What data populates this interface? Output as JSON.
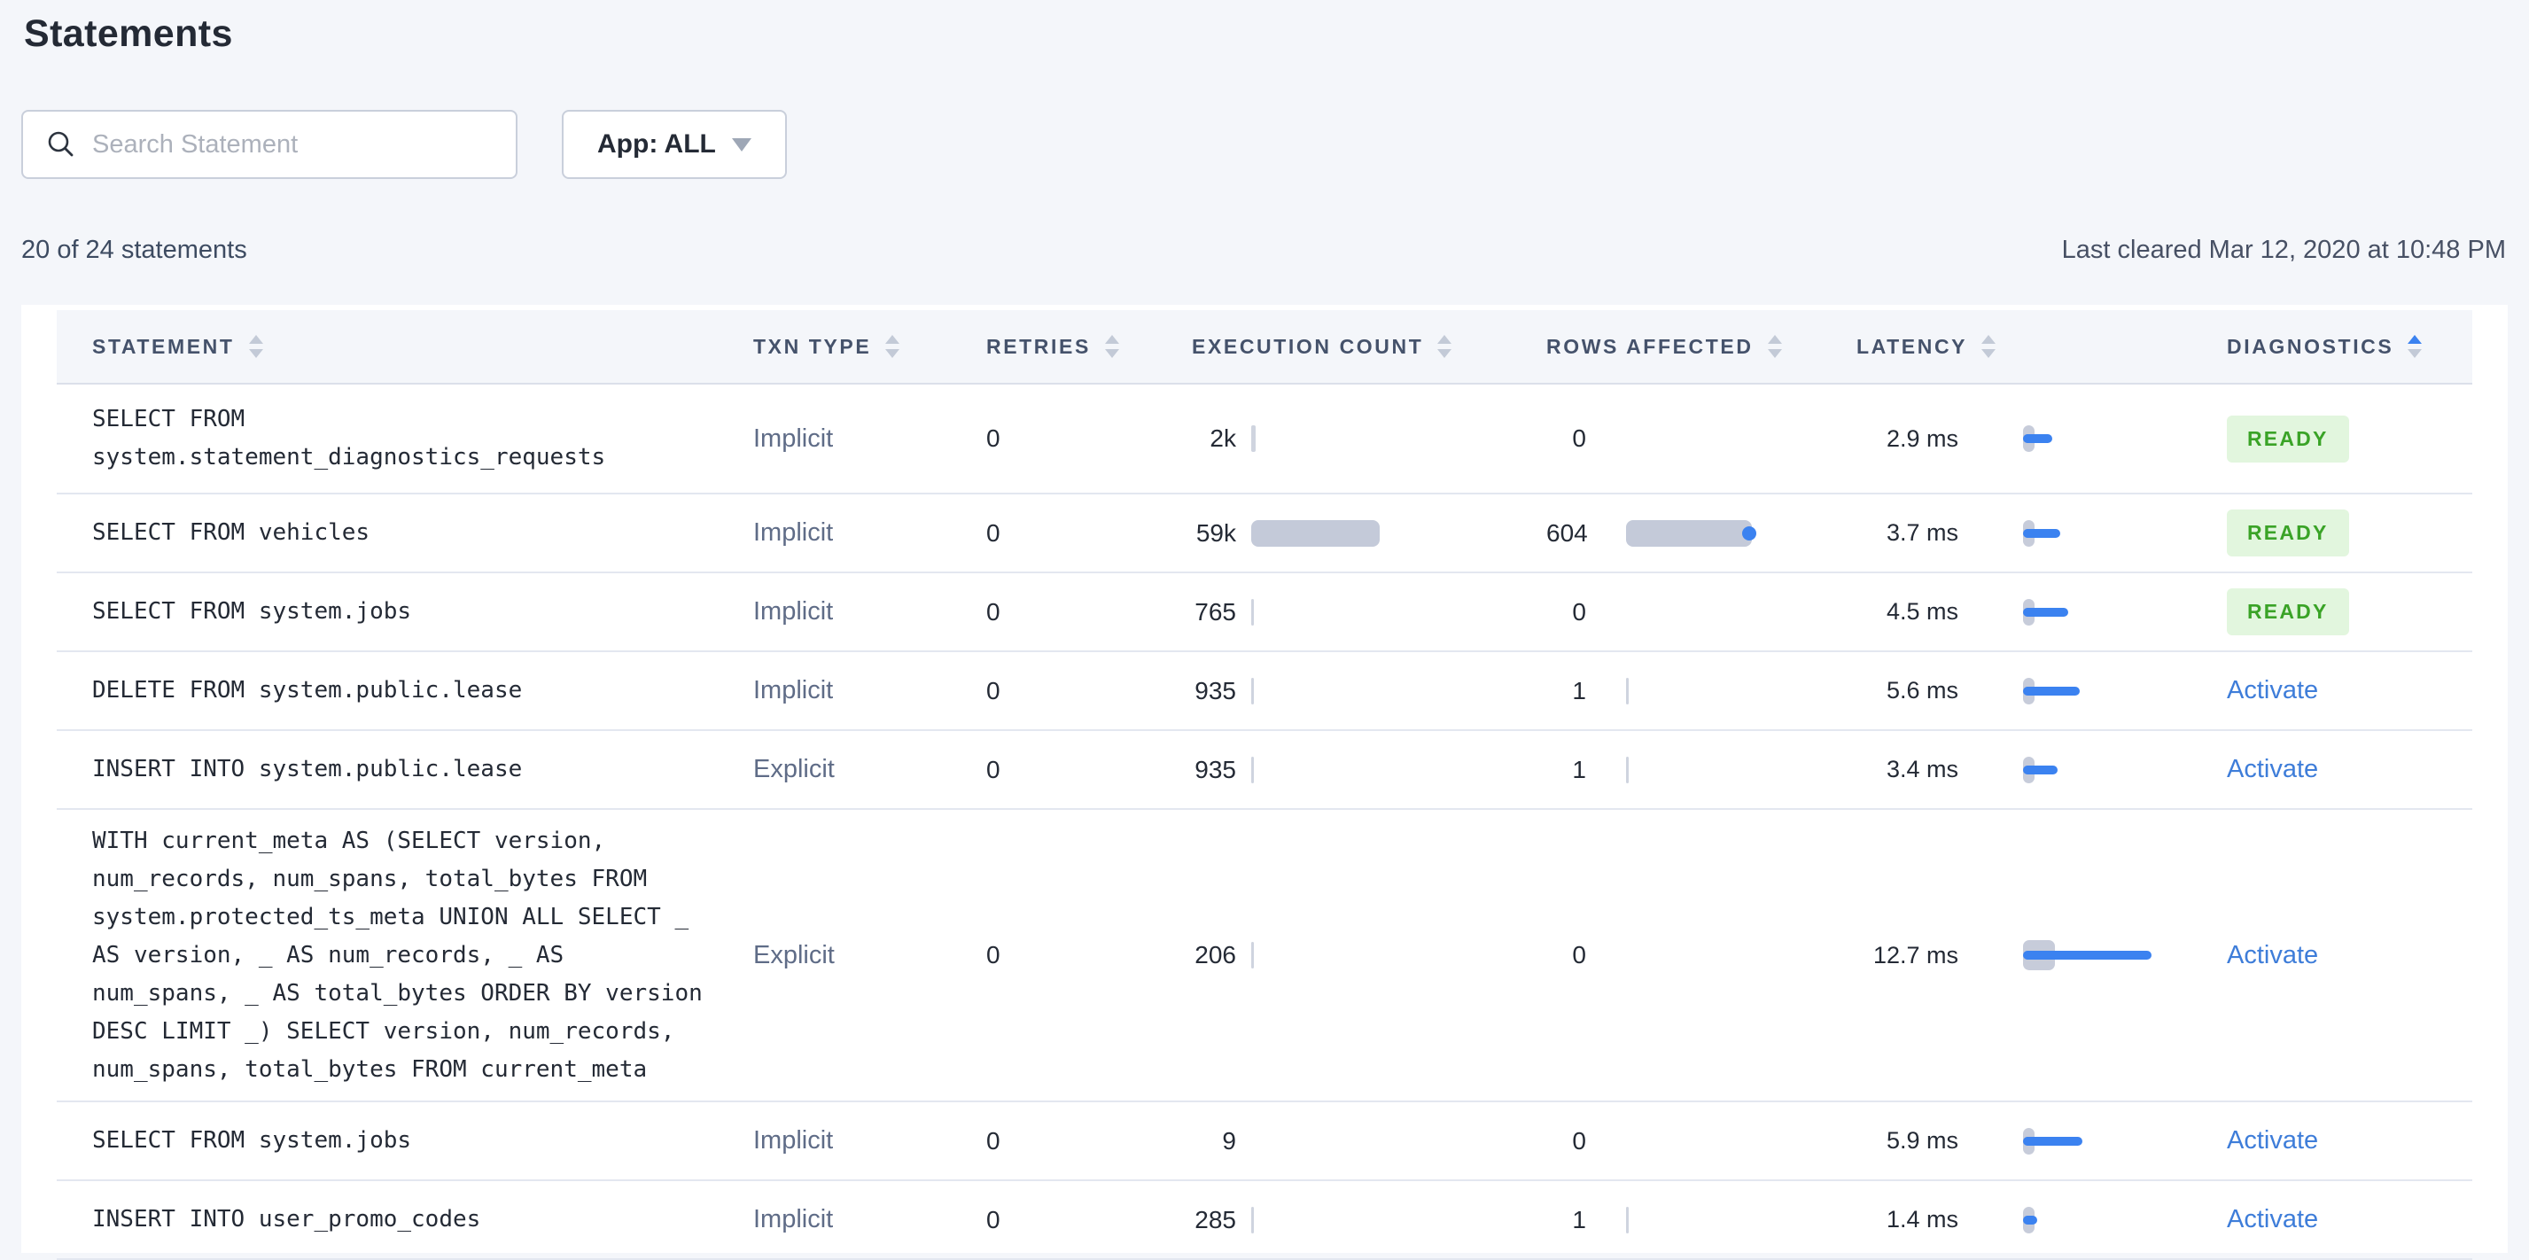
{
  "page": {
    "title": "Statements",
    "search_placeholder": "Search Statement",
    "app_filter_label": "App: ALL",
    "count_text": "20 of 24 statements",
    "last_cleared": "Last cleared Mar 12, 2020 at 10:48 PM"
  },
  "colors": {
    "accent_blue": "#3B82F0",
    "link_blue": "#3E7DD9",
    "badge_green_bg": "#E2F6DE",
    "badge_green_text": "#3AA327",
    "bar_gray": "#C4CAD9",
    "page_bg": "#F4F6FA"
  },
  "table": {
    "columns": [
      {
        "label": "STATEMENT",
        "sort": "none"
      },
      {
        "label": "TXN TYPE",
        "sort": "none"
      },
      {
        "label": "RETRIES",
        "sort": "none"
      },
      {
        "label": "EXECUTION COUNT",
        "sort": "none"
      },
      {
        "label": "ROWS AFFECTED",
        "sort": "none"
      },
      {
        "label": "LATENCY",
        "sort": "none"
      },
      {
        "label": "DIAGNOSTICS",
        "sort": "asc"
      }
    ],
    "rows": [
      {
        "statement_lines": [
          "SELECT FROM",
          "system.statement_diagnostics_requests"
        ],
        "txn_type": "Implicit",
        "retries": "0",
        "execution_count": "2k",
        "execution_count_value": 2000,
        "rows_affected": "0",
        "rows_affected_value": 0,
        "latency": "2.9 ms",
        "latency_value": 2.9,
        "latency_stddev_wide": false,
        "diagnostics": {
          "kind": "badge",
          "label": "READY"
        }
      },
      {
        "statement_lines": [
          "SELECT FROM vehicles"
        ],
        "txn_type": "Implicit",
        "retries": "0",
        "execution_count": "59k",
        "execution_count_value": 59000,
        "rows_affected": "604",
        "rows_affected_value": 604,
        "latency": "3.7 ms",
        "latency_value": 3.7,
        "latency_stddev_wide": false,
        "diagnostics": {
          "kind": "badge",
          "label": "READY"
        }
      },
      {
        "statement_lines": [
          "SELECT FROM system.jobs"
        ],
        "txn_type": "Implicit",
        "retries": "0",
        "execution_count": "765",
        "execution_count_value": 765,
        "rows_affected": "0",
        "rows_affected_value": 0,
        "latency": "4.5 ms",
        "latency_value": 4.5,
        "latency_stddev_wide": false,
        "diagnostics": {
          "kind": "badge",
          "label": "READY"
        }
      },
      {
        "statement_lines": [
          "DELETE FROM system.public.lease"
        ],
        "txn_type": "Implicit",
        "retries": "0",
        "execution_count": "935",
        "execution_count_value": 935,
        "rows_affected": "1",
        "rows_affected_value": 1,
        "latency": "5.6 ms",
        "latency_value": 5.6,
        "latency_stddev_wide": false,
        "diagnostics": {
          "kind": "link",
          "label": "Activate"
        }
      },
      {
        "statement_lines": [
          "INSERT INTO system.public.lease"
        ],
        "txn_type": "Explicit",
        "retries": "0",
        "execution_count": "935",
        "execution_count_value": 935,
        "rows_affected": "1",
        "rows_affected_value": 1,
        "latency": "3.4 ms",
        "latency_value": 3.4,
        "latency_stddev_wide": false,
        "diagnostics": {
          "kind": "link",
          "label": "Activate"
        }
      },
      {
        "statement_lines": [
          "WITH current_meta AS (SELECT version,",
          "num_records, num_spans, total_bytes FROM",
          "system.protected_ts_meta UNION ALL SELECT _",
          "AS version, _ AS num_records, _ AS",
          "num_spans, _ AS total_bytes ORDER BY version",
          "DESC LIMIT _) SELECT version, num_records,",
          "num_spans, total_bytes FROM current_meta"
        ],
        "txn_type": "Explicit",
        "retries": "0",
        "execution_count": "206",
        "execution_count_value": 206,
        "rows_affected": "0",
        "rows_affected_value": 0,
        "latency": "12.7 ms",
        "latency_value": 12.7,
        "latency_stddev_wide": true,
        "diagnostics": {
          "kind": "link",
          "label": "Activate"
        }
      },
      {
        "statement_lines": [
          "SELECT FROM system.jobs"
        ],
        "txn_type": "Implicit",
        "retries": "0",
        "execution_count": "9",
        "execution_count_value": 9,
        "rows_affected": "0",
        "rows_affected_value": 0,
        "latency": "5.9 ms",
        "latency_value": 5.9,
        "latency_stddev_wide": false,
        "diagnostics": {
          "kind": "link",
          "label": "Activate"
        }
      },
      {
        "statement_lines": [
          "INSERT INTO user_promo_codes"
        ],
        "txn_type": "Implicit",
        "retries": "0",
        "execution_count": "285",
        "execution_count_value": 285,
        "rows_affected": "1",
        "rows_affected_value": 1,
        "latency": "1.4 ms",
        "latency_value": 1.4,
        "latency_stddev_wide": false,
        "diagnostics": {
          "kind": "link",
          "label": "Activate"
        }
      }
    ]
  }
}
